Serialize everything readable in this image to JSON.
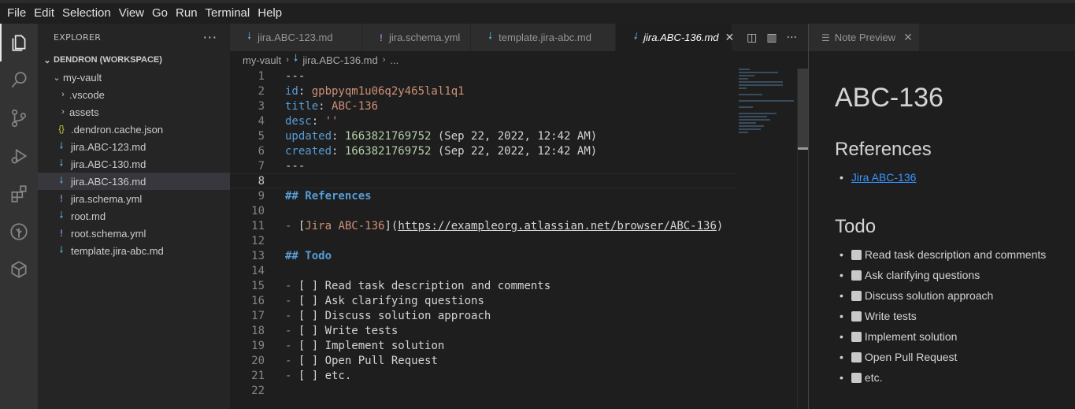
{
  "menu": [
    "File",
    "Edit",
    "Selection",
    "View",
    "Go",
    "Run",
    "Terminal",
    "Help"
  ],
  "sidebar": {
    "title": "EXPLORER",
    "more": "···",
    "workspace": "DENDRON (WORKSPACE)",
    "vault": "my-vault",
    "items": [
      {
        "label": ".vscode",
        "icon": "chevron-right"
      },
      {
        "label": "assets",
        "icon": "chevron-right"
      },
      {
        "label": ".dendron.cache.json",
        "icon": "json-icon"
      },
      {
        "label": "jira.ABC-123.md",
        "icon": "markdown-icon"
      },
      {
        "label": "jira.ABC-130.md",
        "icon": "markdown-icon"
      },
      {
        "label": "jira.ABC-136.md",
        "icon": "markdown-icon",
        "selected": true
      },
      {
        "label": "jira.schema.yml",
        "icon": "yaml-icon"
      },
      {
        "label": "root.md",
        "icon": "markdown-icon"
      },
      {
        "label": "root.schema.yml",
        "icon": "yaml-icon"
      },
      {
        "label": "template.jira-abc.md",
        "icon": "markdown-icon"
      }
    ]
  },
  "tabs": [
    {
      "label": "jira.ABC-123.md",
      "icon": "markdown-icon"
    },
    {
      "label": "jira.schema.yml",
      "icon": "yaml-icon"
    },
    {
      "label": "template.jira-abc.md",
      "icon": "markdown-icon"
    },
    {
      "label": "jira.ABC-136.md",
      "icon": "markdown-icon",
      "active": true
    }
  ],
  "breadcrumb": {
    "vault": "my-vault",
    "file": "jira.ABC-136.md",
    "more": "..."
  },
  "code": {
    "l1": "---",
    "id_key": "id",
    "id_val": "gpbpyqm1u06q2y465lal1q1",
    "title_key": "title",
    "title_val": "ABC-136",
    "desc_key": "desc",
    "desc_val": "''",
    "updated_key": "updated",
    "updated_num": "1663821769752",
    "updated_rest": " (Sep 22, 2022, 12:42 AM)",
    "created_key": "created",
    "created_num": "1663821769752",
    "created_rest": " (Sep 22, 2022, 12:42 AM)",
    "l7": "---",
    "refs_heading": "## References",
    "link_text": "Jira ABC-136",
    "link_url": "https://exampleorg.atlassian.net/browser/ABC-136",
    "todo_heading": "## Todo",
    "todos": [
      "Read task description and comments",
      "Ask clarifying questions",
      "Discuss solution approach",
      "Write tests",
      "Implement solution",
      "Open Pull Request",
      "etc."
    ]
  },
  "preview": {
    "tab_label": "Note Preview",
    "title": "ABC-136",
    "refs_heading": "References",
    "link": "Jira ABC-136",
    "todo_heading": "Todo",
    "todos": [
      "Read task description and comments",
      "Ask clarifying questions",
      "Discuss solution approach",
      "Write tests",
      "Implement solution",
      "Open Pull Request",
      "etc."
    ]
  }
}
